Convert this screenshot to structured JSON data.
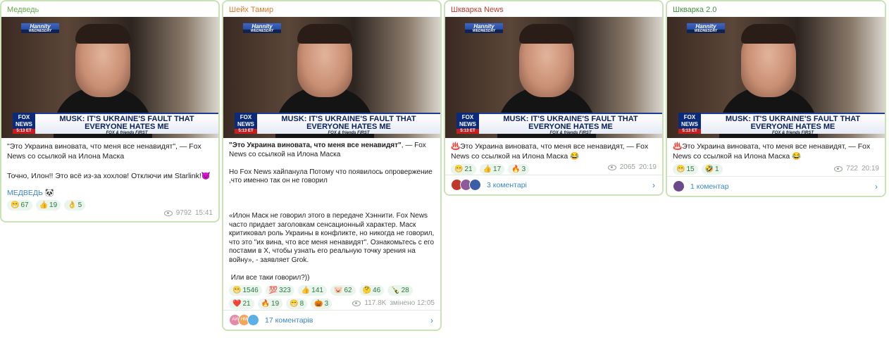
{
  "colors": {
    "accent": "#3b86c6",
    "reaction_bg": "#eaf5ee",
    "border": "#c9e3b6"
  },
  "media": {
    "show": "Hannity",
    "show_sub": "WEDNESDAY",
    "headline1": "MUSK: IT'S UKRAINE'S FAULT THAT",
    "headline2": "EVERYONE HATES ME",
    "fnf": "FOX & friends FIRST",
    "logo": "FOX NEWS",
    "time": "5:13 ET"
  },
  "posts": [
    {
      "author": "Медведь",
      "author_color": "#6aa84f",
      "text": "\"Это Украина виновата, что меня все ненавидят\", — Fox News со ссылкой на Илона Маска\n\nТочно, Илон!! Это всё из-за хохлов! Отключи им Starlink!👿",
      "signature": "МЕДВЕДЬ 🐼",
      "reactions": [
        {
          "emoji": "😁",
          "count": "67"
        },
        {
          "emoji": "👍",
          "count": "19"
        },
        {
          "emoji": "👌",
          "count": "5"
        }
      ],
      "views": "9792",
      "time": "15:41"
    },
    {
      "author": "Шейх Тамир",
      "author_color": "#e07a2a",
      "text_bold": "\"Это Украина виновата, что меня все ненавидят\"",
      "text": ", — Fox News со ссылкой на Илона Маска\n\nНо Fox News хайпанула Потому что появилось опровержение ,что именно так он не говорил\n\n\n\n«Илон Маск не говорил этого в передаче Хэннити. Fox News часто придает заголовкам сенсационный характер. Маск критиковал роль Украины в конфликте, но никогда не говорил, что это \"их вина, что все меня ненавидят\". Ознакомьтесь с его постами в X, чтобы узнать его реальную точку зрения на войну», - заявляет Grok.\n\n Или все таки говорил?))",
      "reactions": [
        {
          "emoji": "😁",
          "count": "1546"
        },
        {
          "emoji": "💯",
          "count": "323"
        },
        {
          "emoji": "👍",
          "count": "141"
        },
        {
          "emoji": "🐷",
          "count": "62"
        },
        {
          "emoji": "🤔",
          "count": "46"
        },
        {
          "emoji": "🍾",
          "count": "28"
        },
        {
          "emoji": "❤️",
          "count": "21"
        },
        {
          "emoji": "🔥",
          "count": "19"
        },
        {
          "emoji": "😁",
          "count": "8"
        },
        {
          "emoji": "🎃",
          "count": "3"
        }
      ],
      "views": "117.8K",
      "time": "змінено 12:05",
      "comments": "17 коментарів"
    },
    {
      "author": "Шкварка News",
      "author_color": "#c0392b",
      "text": "♨️Это Украина виновата, что меня все ненавидят, — Fox News со ссылкой на Илона Маска 😂",
      "reactions": [
        {
          "emoji": "😁",
          "count": "21"
        },
        {
          "emoji": "👍",
          "count": "17"
        },
        {
          "emoji": "🔥",
          "count": "3"
        }
      ],
      "views": "2065",
      "time": "20:19",
      "comments": "3 коментарі"
    },
    {
      "author": "Шкварка 2.0",
      "author_color": "#3f8f3f",
      "text": "♨️Это Украина виновата, что меня все ненавидят, — Fox News со ссылкой на Илона Маска 😂",
      "reactions": [
        {
          "emoji": "😁",
          "count": "15"
        },
        {
          "emoji": "🤣",
          "count": "1"
        }
      ],
      "views": "722",
      "time": "20:19",
      "comments": "1 коментар"
    }
  ]
}
